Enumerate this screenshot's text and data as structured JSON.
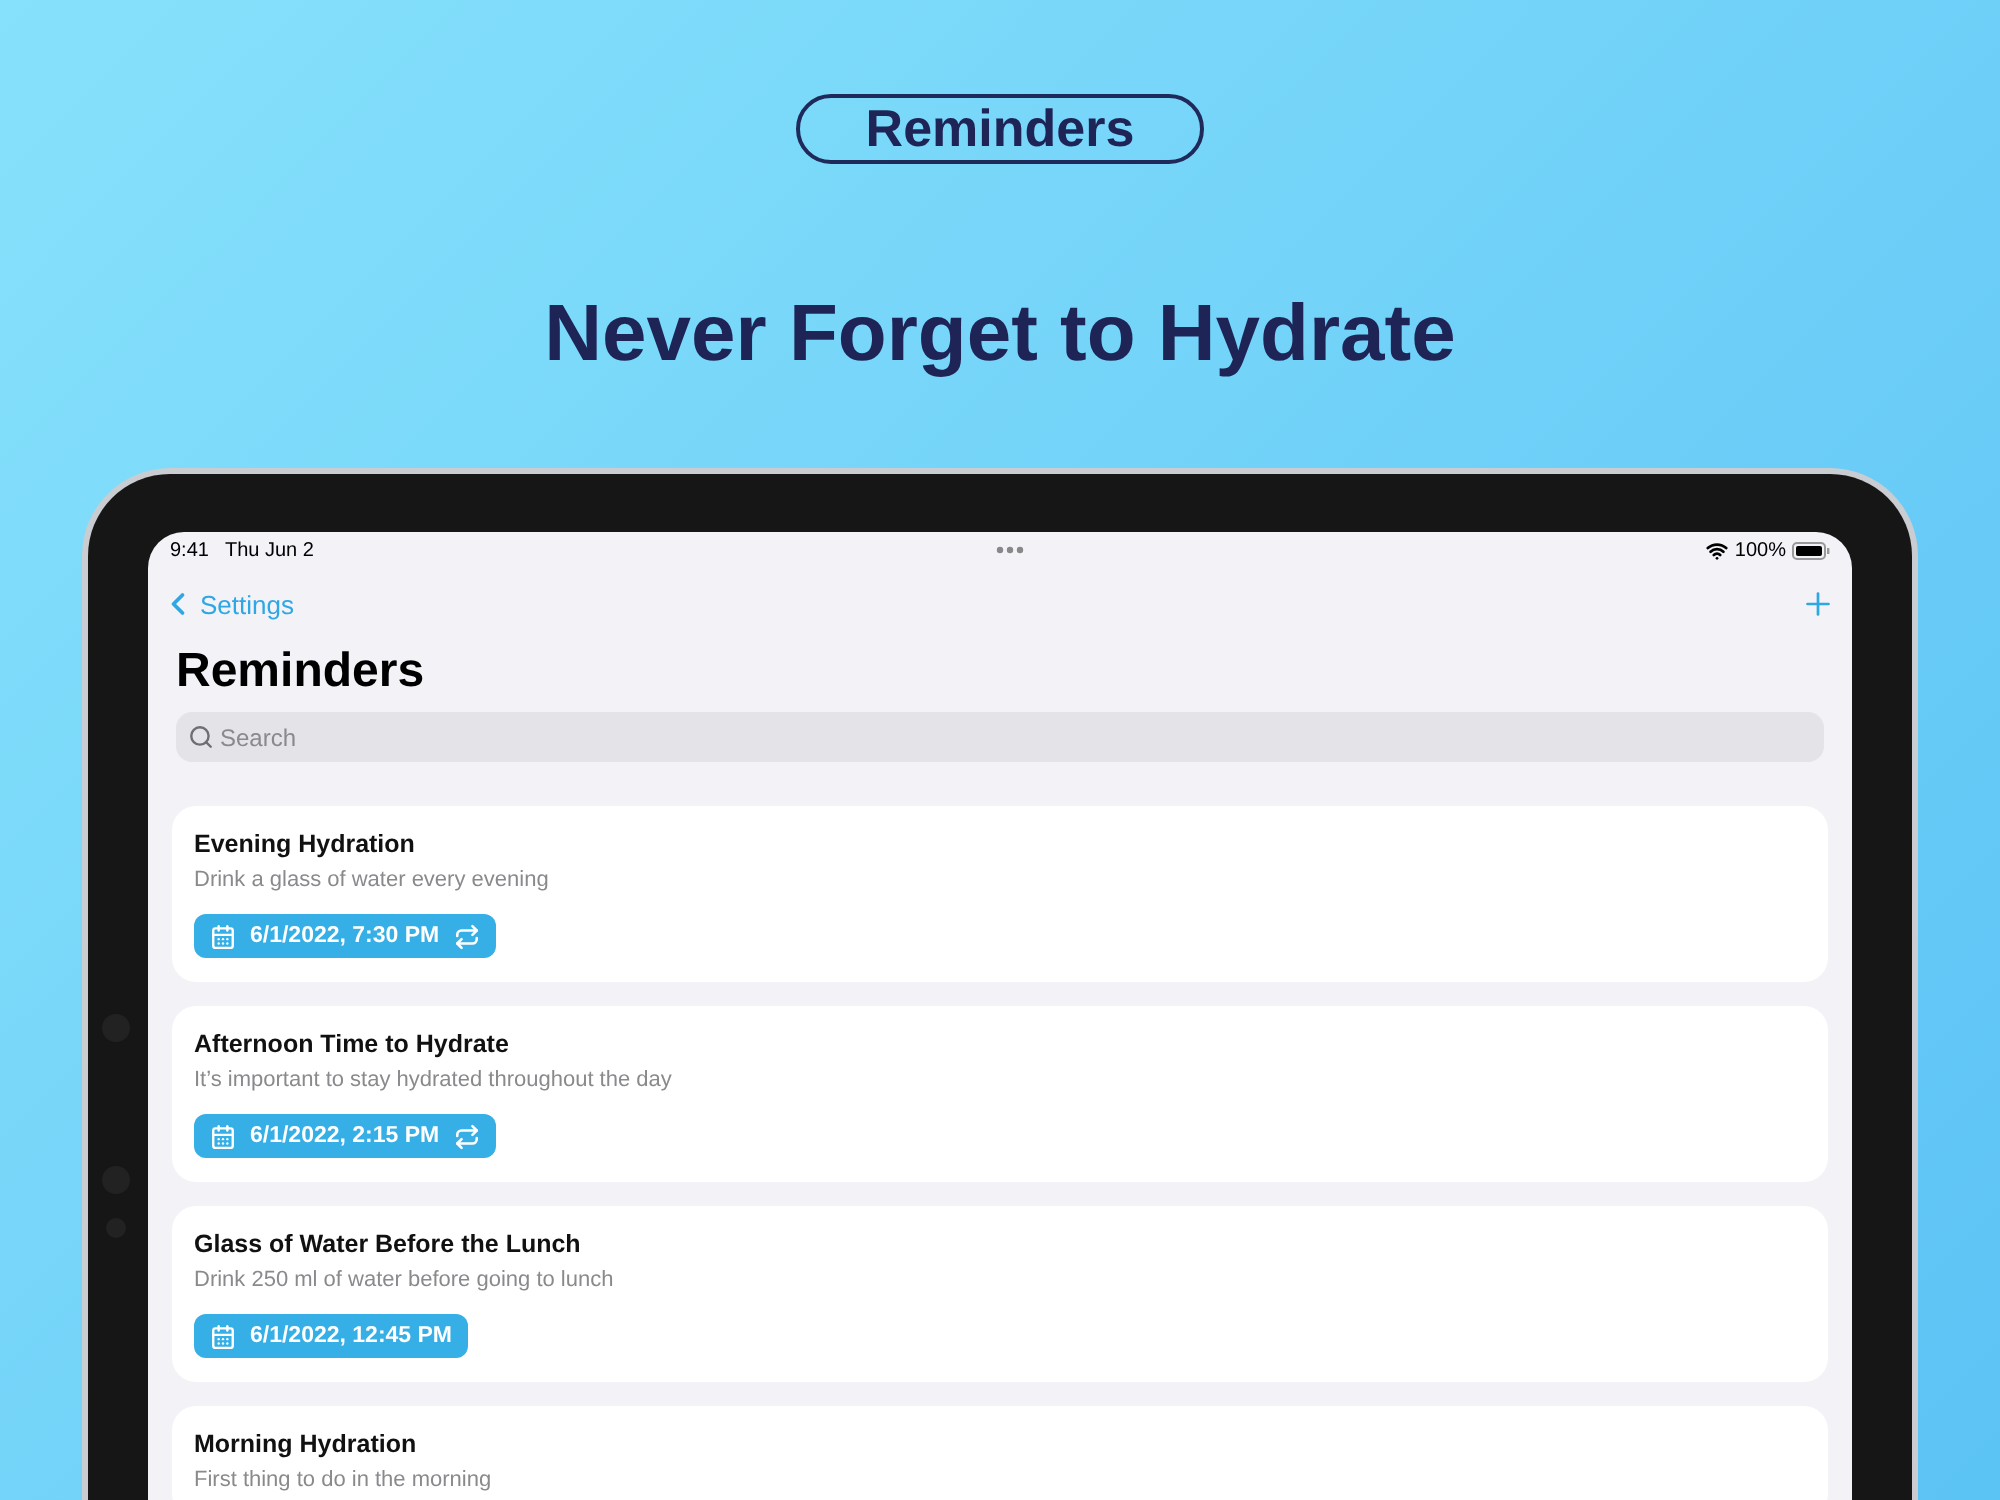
{
  "badge": "Reminders",
  "headline": "Never Forget to Hydrate",
  "status_bar": {
    "time": "9:41",
    "date": "Thu Jun 2",
    "battery": "100%"
  },
  "nav": {
    "back": "Settings"
  },
  "title": "Reminders",
  "search": {
    "placeholder": "Search"
  },
  "reminders": [
    {
      "title": "Evening Hydration",
      "note": "Drink a glass of water every evening",
      "date": "6/1/2022, 7:30 PM",
      "repeating": true
    },
    {
      "title": "Afternoon Time to Hydrate",
      "note": "It’s important to stay hydrated throughout the day",
      "date": "6/1/2022, 2:15 PM",
      "repeating": true
    },
    {
      "title": "Glass of Water Before the Lunch",
      "note": "Drink 250 ml of water before going to lunch",
      "date": "6/1/2022, 12:45 PM",
      "repeating": false
    },
    {
      "title": "Morning Hydration",
      "note": "First thing to do in the morning"
    }
  ]
}
